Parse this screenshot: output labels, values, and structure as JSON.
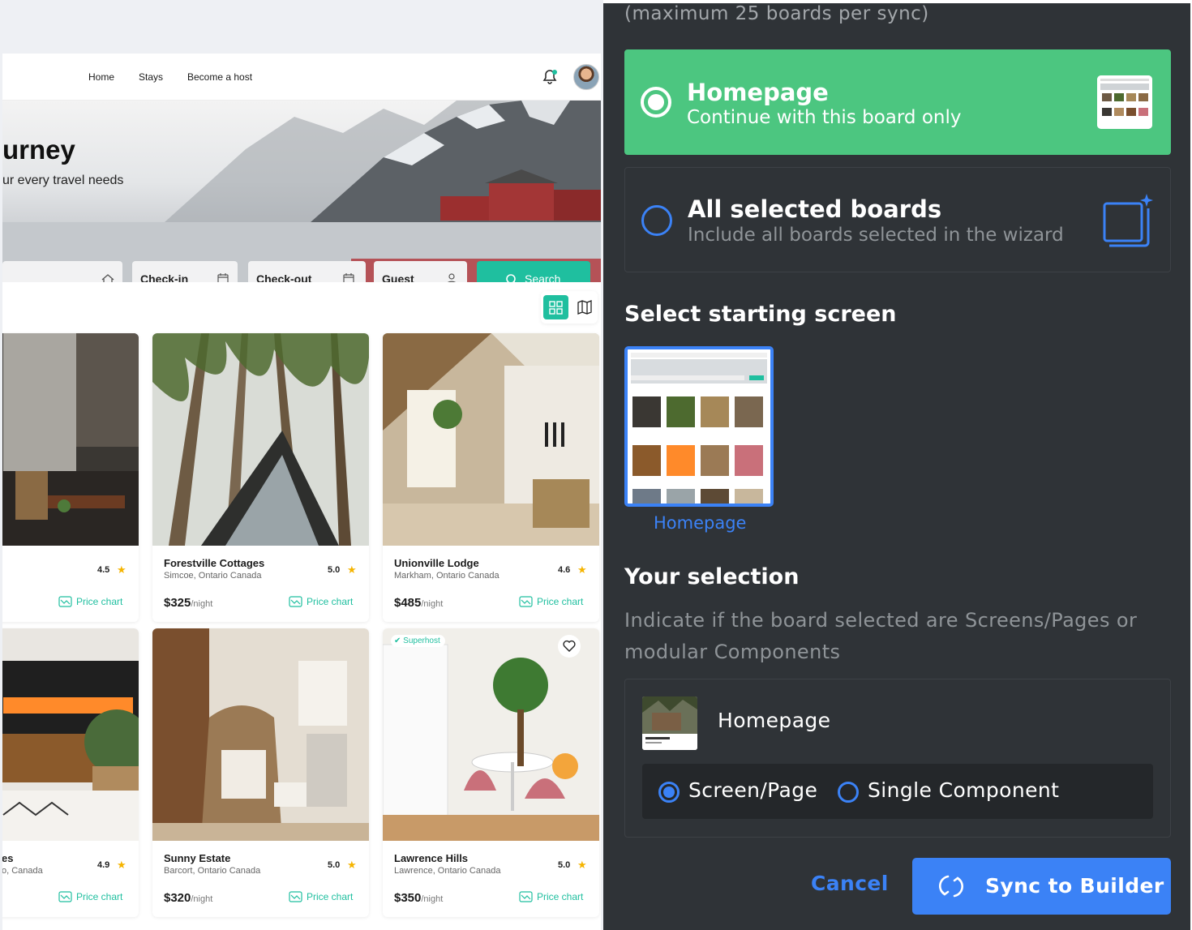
{
  "site": {
    "nav": {
      "home": "Home",
      "stays": "Stays",
      "host": "Become a host"
    },
    "hero": {
      "title": "urney",
      "subtitle": "ur every travel needs"
    },
    "search": {
      "checkin": "Check-in",
      "checkout": "Check-out",
      "guest": "Guest",
      "button": "Search"
    },
    "price_chart_label": "Price chart",
    "per_night": "/night",
    "superhost": "Superhost",
    "cards": [
      {
        "name": "",
        "location": "",
        "rating": "4.5",
        "price": ""
      },
      {
        "name": "Forestville Cottages",
        "location": "Simcoe, Ontario Canada",
        "rating": "5.0",
        "price": "$325"
      },
      {
        "name": "Unionville Lodge",
        "location": "Markham, Ontario Canada",
        "rating": "4.6",
        "price": "$485"
      },
      {
        "name": "es",
        "location": "o, Canada",
        "rating": "4.9",
        "price": ""
      },
      {
        "name": "Sunny Estate",
        "location": "Barcort, Ontario Canada",
        "rating": "5.0",
        "price": "$320"
      },
      {
        "name": "Lawrence Hills",
        "location": "Lawrence, Ontario Canada",
        "rating": "5.0",
        "price": "$350"
      }
    ]
  },
  "panel": {
    "caption": "(maximum 25 boards per sync)",
    "option_homepage": {
      "title": "Homepage",
      "subtitle": "Continue with this board only"
    },
    "option_all": {
      "title": "All selected boards",
      "subtitle": "Include all boards selected in the wizard"
    },
    "starting_screen": {
      "heading": "Select starting screen",
      "label": "Homepage"
    },
    "selection": {
      "heading": "Your selection",
      "description": "Indicate if the board selected are Screens/Pages or modular Components",
      "board_name": "Homepage",
      "screen_page": "Screen/Page",
      "single_component": "Single Component"
    },
    "cancel": "Cancel",
    "sync": "Sync to Builder"
  },
  "colors": {
    "accent_green": "#4cc680",
    "brand_teal": "#1fbf9f",
    "accent_blue": "#3b82f6",
    "panel_bg": "#2f3337"
  },
  "icons": [
    "bell-icon",
    "home-icon",
    "calendar-icon",
    "user-icon",
    "search-icon",
    "grid-icon",
    "map-icon",
    "star-icon",
    "price-chart-icon",
    "heart-icon",
    "stack-sparkle-icon",
    "sync-icon"
  ]
}
